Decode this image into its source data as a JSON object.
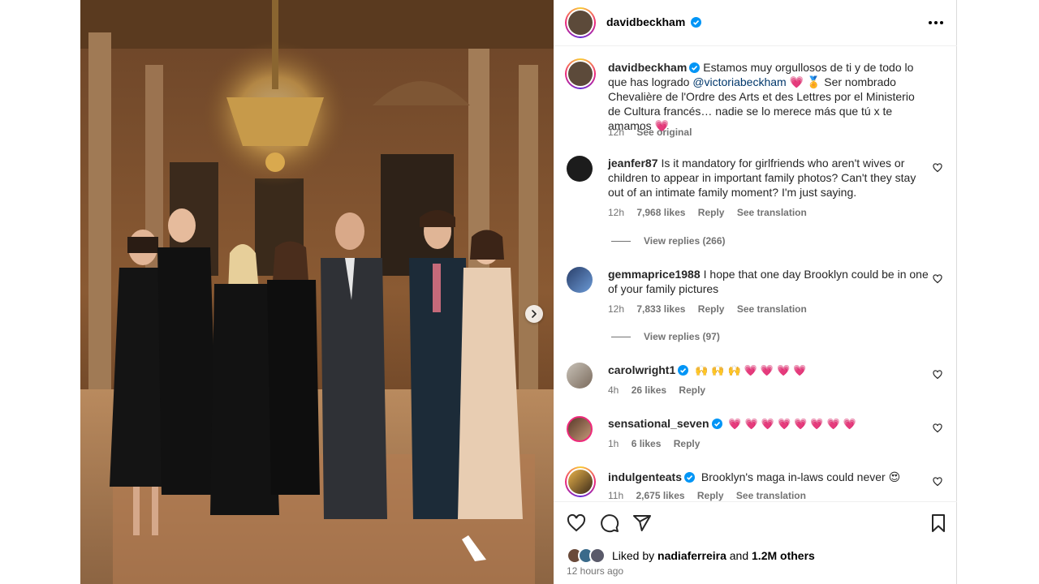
{
  "post": {
    "author": "davidbeckham",
    "caption_text": "Estamos muy orgullosos de ti y de todo lo que has logrado ",
    "caption_mention": "@victoriabeckham",
    "caption_text2": " Ser nombrado Chevalière de l'Ordre des Arts et des Lettres por el Ministerio de Cultura francés… nadie se lo merece más que tú x te amamos ",
    "caption_heart": "💗",
    "caption_time": "12h",
    "see_original": "See original",
    "accent_color": "#0095f6"
  },
  "comments": [
    {
      "username": "jeanfer87",
      "text": "Is it mandatory for girlfriends who aren't wives or children to appear in important family photos? Can't they stay out of an intimate family moment? I'm just saying.",
      "time": "12h",
      "likes": "7,968 likes",
      "reply": "Reply",
      "translate": "See translation",
      "view_replies": "View replies (266)"
    },
    {
      "username": "gemmaprice1988",
      "text": "I hope that one day Brooklyn could be in one of your family pictures",
      "time": "12h",
      "likes": "7,833 likes",
      "reply": "Reply",
      "translate": "See translation",
      "view_replies": "View replies (97)"
    },
    {
      "username": "carolwright1",
      "text": "🙌🙌🙌💗💗💗💗",
      "time": "4h",
      "likes": "26 likes",
      "reply": "Reply"
    },
    {
      "username": "sensational_seven",
      "text": "💗💗💗💗💗💗💗💗",
      "time": "1h",
      "likes": "6 likes",
      "reply": "Reply"
    },
    {
      "username": "indulgenteats",
      "text": "Brooklyn's maga in-laws could never 😍",
      "time": "11h",
      "likes": "2,675 likes",
      "reply": "Reply",
      "translate": "See translation"
    }
  ],
  "footer": {
    "liked_prefix": "Liked by",
    "liked_user": "nadiaferreira",
    "liked_and": "and",
    "liked_count": "1.2M others",
    "time_ago": "12 hours ago"
  }
}
